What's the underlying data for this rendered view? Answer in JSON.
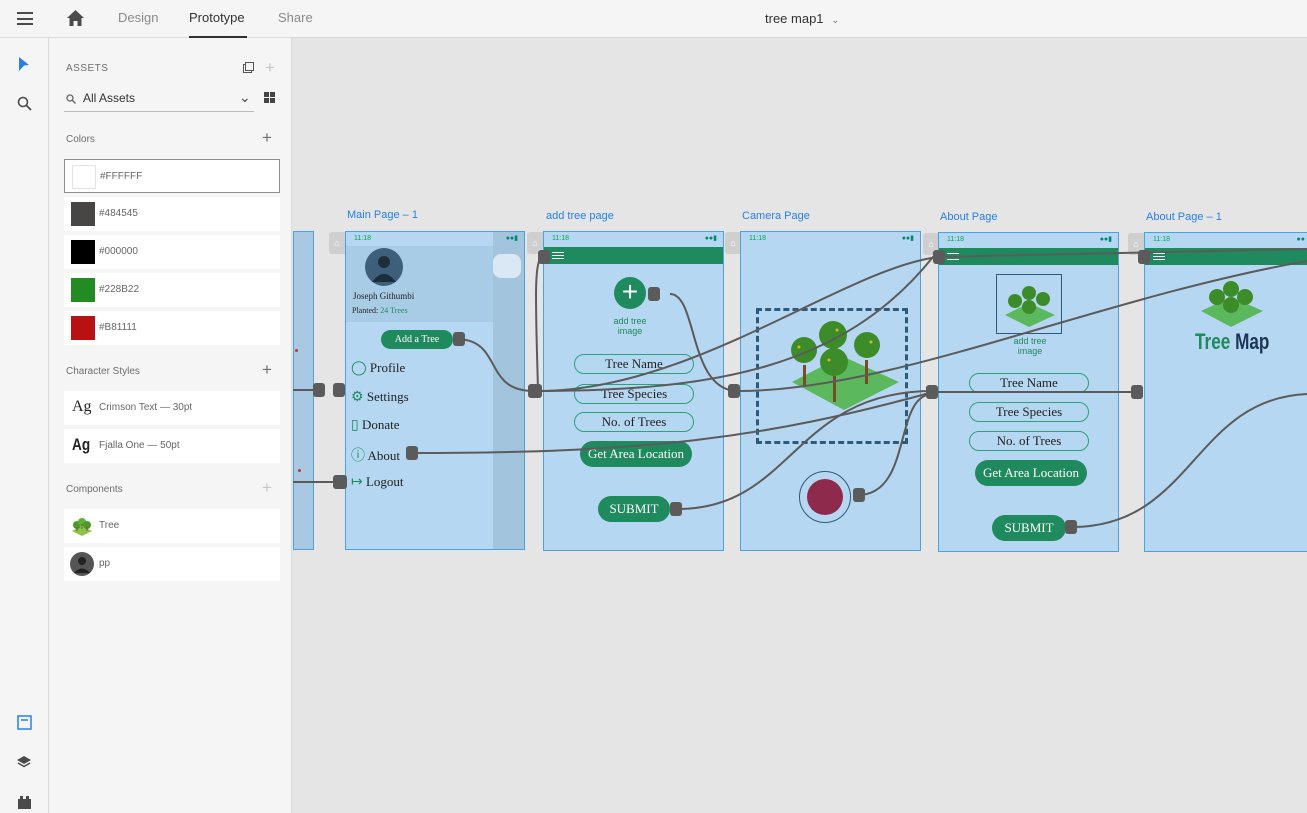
{
  "topbar": {
    "tabs": [
      {
        "label": "Design"
      },
      {
        "label": "Prototype"
      },
      {
        "label": "Share"
      }
    ],
    "document_title": "tree map1"
  },
  "assets": {
    "title": "ASSETS",
    "search_value": "All Assets",
    "colors_label": "Colors",
    "colors": [
      {
        "label": "#FFFFFF",
        "hex": "#FFFFFF"
      },
      {
        "label": "#484545",
        "hex": "#484545"
      },
      {
        "label": "#000000",
        "hex": "#000000"
      },
      {
        "label": "#228B22",
        "hex": "#228B22"
      },
      {
        "label": "#B81111",
        "hex": "#B81111"
      }
    ],
    "char_styles_label": "Character Styles",
    "char_styles": [
      {
        "sample": "Ag",
        "label": "Crimson Text — 30pt"
      },
      {
        "sample": "Ag",
        "label": "Fjalla One — 50pt"
      }
    ],
    "components_label": "Components",
    "components": [
      {
        "label": "Tree"
      },
      {
        "label": "pp"
      }
    ]
  },
  "artboards": {
    "main": {
      "label": "Main Page – 1",
      "time": "11:18",
      "user_name": "Joseph Githumbi",
      "planted_label": "Planted:",
      "planted_value": "24 Trees",
      "add_button": "Add a Tree",
      "menu": [
        {
          "label": "Profile"
        },
        {
          "label": "Settings"
        },
        {
          "label": "Donate"
        },
        {
          "label": "About"
        },
        {
          "label": "Logout"
        }
      ]
    },
    "addtree": {
      "label": "add tree page",
      "time": "11:18",
      "add_image_line1": "add tree",
      "add_image_line2": "image",
      "fields": [
        "Tree Name",
        "Tree Species",
        "No. of Trees"
      ],
      "location_button": "Get Area Location",
      "submit": "SUBMIT"
    },
    "camera": {
      "label": "Camera Page",
      "time": "11:18"
    },
    "about": {
      "label": "About Page",
      "time": "11:18",
      "add_image_line1": "add tree",
      "add_image_line2": "image",
      "fields": [
        "Tree Name",
        "Tree Species",
        "No. of Trees"
      ],
      "location_button": "Get Area Location",
      "submit": "SUBMIT"
    },
    "about1": {
      "label": "About Page – 1",
      "time": "11:18",
      "logo_word1": "Tree",
      "logo_word2": "Map"
    }
  },
  "colors": {
    "accent_green": "#1f8a5e",
    "artboard_fill": "#b6d7f1",
    "selection_blue": "#2680eb"
  }
}
